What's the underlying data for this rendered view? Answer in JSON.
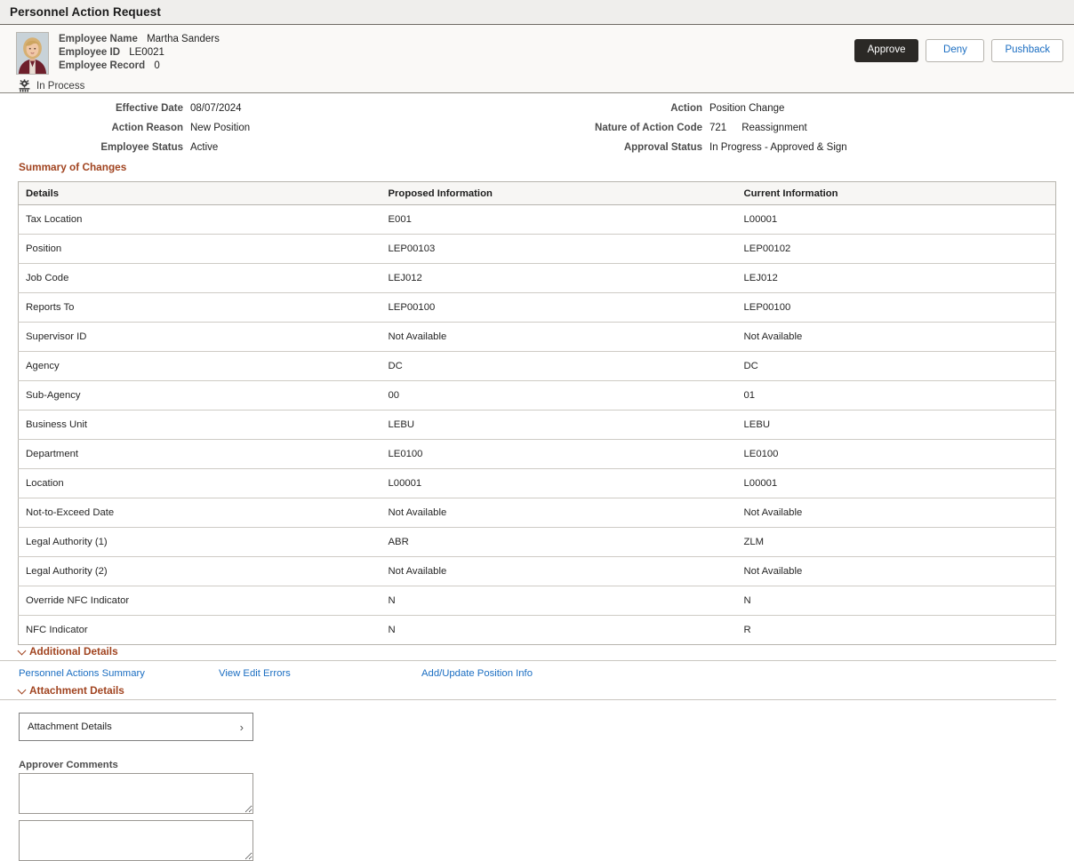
{
  "page": {
    "title": "Personnel Action Request"
  },
  "employee": {
    "name_label": "Employee Name",
    "name_value": "Martha Sanders",
    "id_label": "Employee ID",
    "id_value": "LE0021",
    "record_label": "Employee Record",
    "record_value": "0",
    "status_icon": "in-process-gear-icon",
    "status_text": "In Process",
    "avatar_alt": "employee-photo"
  },
  "actions": {
    "approve_label": "Approve",
    "deny_label": "Deny",
    "pushback_label": "Pushback"
  },
  "summary_fields": {
    "left": [
      {
        "label": "Effective Date",
        "value": "08/07/2024"
      },
      {
        "label": "Action Reason",
        "value": "New Position"
      },
      {
        "label": "Employee Status",
        "value": "Active"
      }
    ],
    "right": [
      {
        "label": "Action",
        "value": "Position Change",
        "value2": ""
      },
      {
        "label": "Nature of Action Code",
        "value": "721",
        "value2": "Reassignment"
      },
      {
        "label": "Approval Status",
        "value": "In Progress - Approved & Sign",
        "value2": ""
      }
    ]
  },
  "summary_of_changes": {
    "heading": "Summary of Changes",
    "columns": [
      "Details",
      "Proposed Information",
      "Current Information"
    ],
    "rows": [
      {
        "detail": "Tax Location",
        "proposed": "E001",
        "current": "L00001"
      },
      {
        "detail": "Position",
        "proposed": "LEP00103",
        "current": "LEP00102"
      },
      {
        "detail": "Job Code",
        "proposed": "LEJ012",
        "current": "LEJ012"
      },
      {
        "detail": "Reports To",
        "proposed": "LEP00100",
        "current": "LEP00100"
      },
      {
        "detail": "Supervisor ID",
        "proposed": "Not Available",
        "current": "Not Available"
      },
      {
        "detail": "Agency",
        "proposed": "DC",
        "current": "DC"
      },
      {
        "detail": "Sub-Agency",
        "proposed": "00",
        "current": "01"
      },
      {
        "detail": "Business Unit",
        "proposed": "LEBU",
        "current": "LEBU"
      },
      {
        "detail": "Department",
        "proposed": "LE0100",
        "current": "LE0100"
      },
      {
        "detail": "Location",
        "proposed": "L00001",
        "current": "L00001"
      },
      {
        "detail": "Not-to-Exceed Date",
        "proposed": "Not Available",
        "current": "Not Available"
      },
      {
        "detail": "Legal Authority (1)",
        "proposed": "ABR",
        "current": "ZLM"
      },
      {
        "detail": "Legal Authority (2)",
        "proposed": "Not Available",
        "current": "Not Available"
      },
      {
        "detail": "Override NFC Indicator",
        "proposed": "N",
        "current": "N"
      },
      {
        "detail": "NFC Indicator",
        "proposed": "N",
        "current": "R"
      }
    ]
  },
  "additional_details": {
    "heading": "Additional Details",
    "links": [
      "Personnel Actions Summary",
      "View Edit Errors",
      "Add/Update Position Info"
    ]
  },
  "attachment_details": {
    "heading": "Attachment Details",
    "button_label": "Attachment Details",
    "button_arrow": "›"
  },
  "approver_comments": {
    "label": "Approver Comments",
    "value": "",
    "placeholder": "",
    "value2": "",
    "placeholder2": ""
  },
  "colors": {
    "accent_heading": "#a14420",
    "link": "#1b6ec2",
    "primary_button_bg": "#2b2926",
    "titlebar_bg": "#efeeec",
    "band_bg": "#faf9f7"
  }
}
